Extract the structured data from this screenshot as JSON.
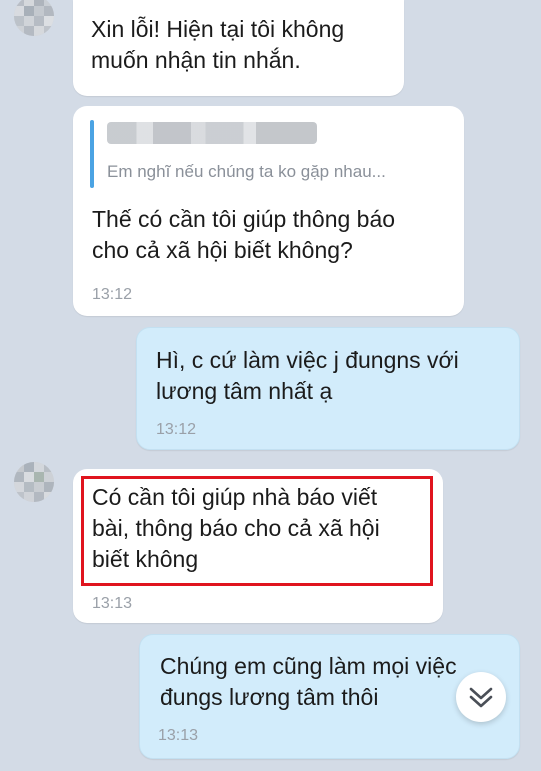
{
  "messages": [
    {
      "direction": "incoming",
      "text": "Xin lỗi! Hiện tại tôi không\nmuốn nhận tin nhắn."
    },
    {
      "direction": "incoming",
      "quote_preview": "Em nghĩ nếu chúng ta ko gặp nhau...",
      "text": "Thế có cần tôi giúp thông báo\ncho cả xã hội biết không?",
      "time": "13:12"
    },
    {
      "direction": "outgoing",
      "text": "Hì, c cứ làm việc j đungns với\nlương tâm nhất ạ",
      "time": "13:12"
    },
    {
      "direction": "incoming",
      "text": "Có cần tôi giúp nhà báo viết\nbài, thông báo cho cả xã hội\nbiết không",
      "time": "13:13",
      "highlighted": true
    },
    {
      "direction": "outgoing",
      "text": "Chúng em cũng làm mọi việc\nđungs lương tâm thôi",
      "time": "13:13"
    }
  ],
  "colors": {
    "background": "#d3dbe6",
    "incoming_bubble": "#ffffff",
    "outgoing_bubble": "#d2ecfb",
    "quote_bar": "#4ba3e3",
    "highlight": "#e0141e"
  },
  "icons": {
    "scroll_down": "double-chevron-down-icon"
  }
}
